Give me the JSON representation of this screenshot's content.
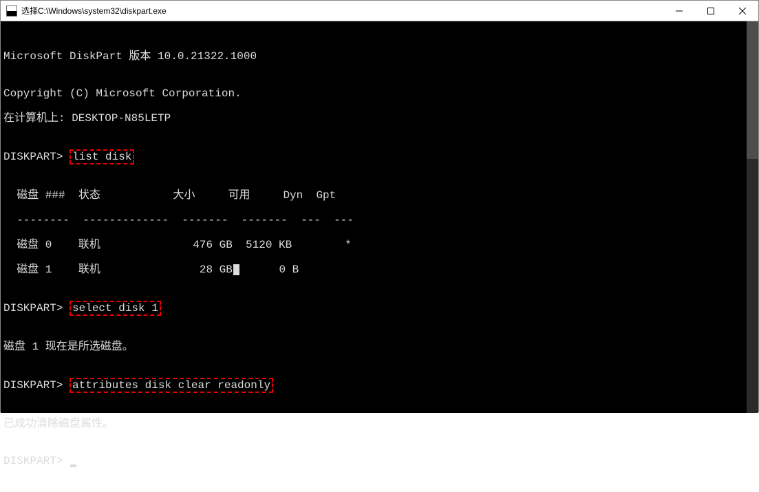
{
  "window": {
    "title": "选择C:\\Windows\\system32\\diskpart.exe"
  },
  "terminal": {
    "blank0": "",
    "version": "Microsoft DiskPart 版本 10.0.21322.1000",
    "blank1": "",
    "copyright": "Copyright (C) Microsoft Corporation.",
    "computer": "在计算机上: DESKTOP-N85LETP",
    "blank2": "",
    "prompt1_prefix": "DISKPART> ",
    "cmd1": "list disk",
    "blank3": "",
    "header": "  磁盘 ###  状态           大小     可用     Dyn  Gpt",
    "divider": "  --------  -------------  -------  -------  ---  ---",
    "row0": "  磁盘 0    联机              476 GB  5120 KB        *",
    "row1a": "  磁盘 1    联机               28 GB",
    "row1b": "      0 B",
    "blank4": "",
    "prompt2_prefix": "DISKPART> ",
    "cmd2": "select disk 1",
    "blank5": "",
    "msg1": "磁盘 1 现在是所选磁盘。",
    "blank6": "",
    "prompt3_prefix": "DISKPART> ",
    "cmd3": "attributes disk clear readonly",
    "blank7": "",
    "msg2": "已成功清除磁盘属性。",
    "blank8": "",
    "prompt4": "DISKPART> "
  }
}
